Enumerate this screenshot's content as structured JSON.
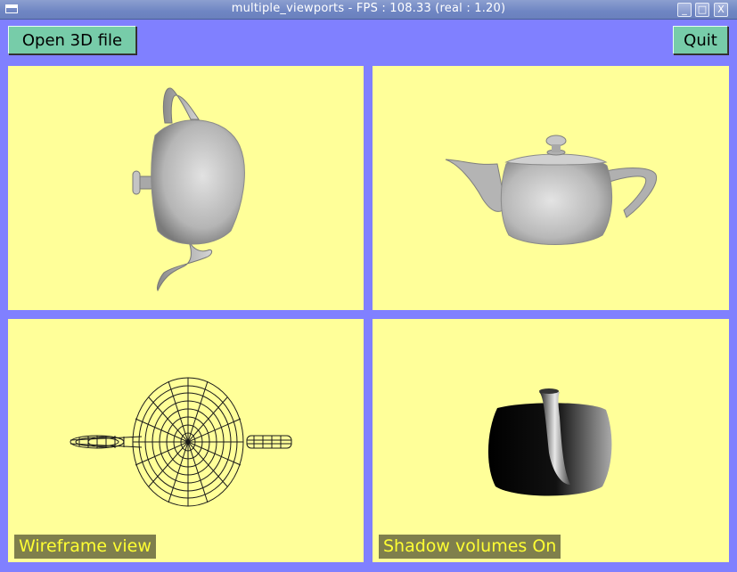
{
  "window": {
    "title": "multiple_viewports - FPS : 108.33 (real : 1.20)",
    "minimize_glyph": "_",
    "maximize_glyph": "□",
    "close_glyph": "X"
  },
  "toolbar": {
    "open_label": "Open 3D file",
    "quit_label": "Quit"
  },
  "viewports": {
    "top_left": {
      "view": "top"
    },
    "top_right": {
      "view": "front"
    },
    "bottom_left": {
      "view": "wireframe",
      "label": "Wireframe view"
    },
    "bottom_right": {
      "view": "shadow",
      "label": "Shadow volumes On"
    }
  },
  "colors": {
    "background": "#8080ff",
    "viewport": "#ffff99",
    "button": "#77cca9",
    "label_bg": "#7f7f4c",
    "label_text": "#ffff33"
  }
}
